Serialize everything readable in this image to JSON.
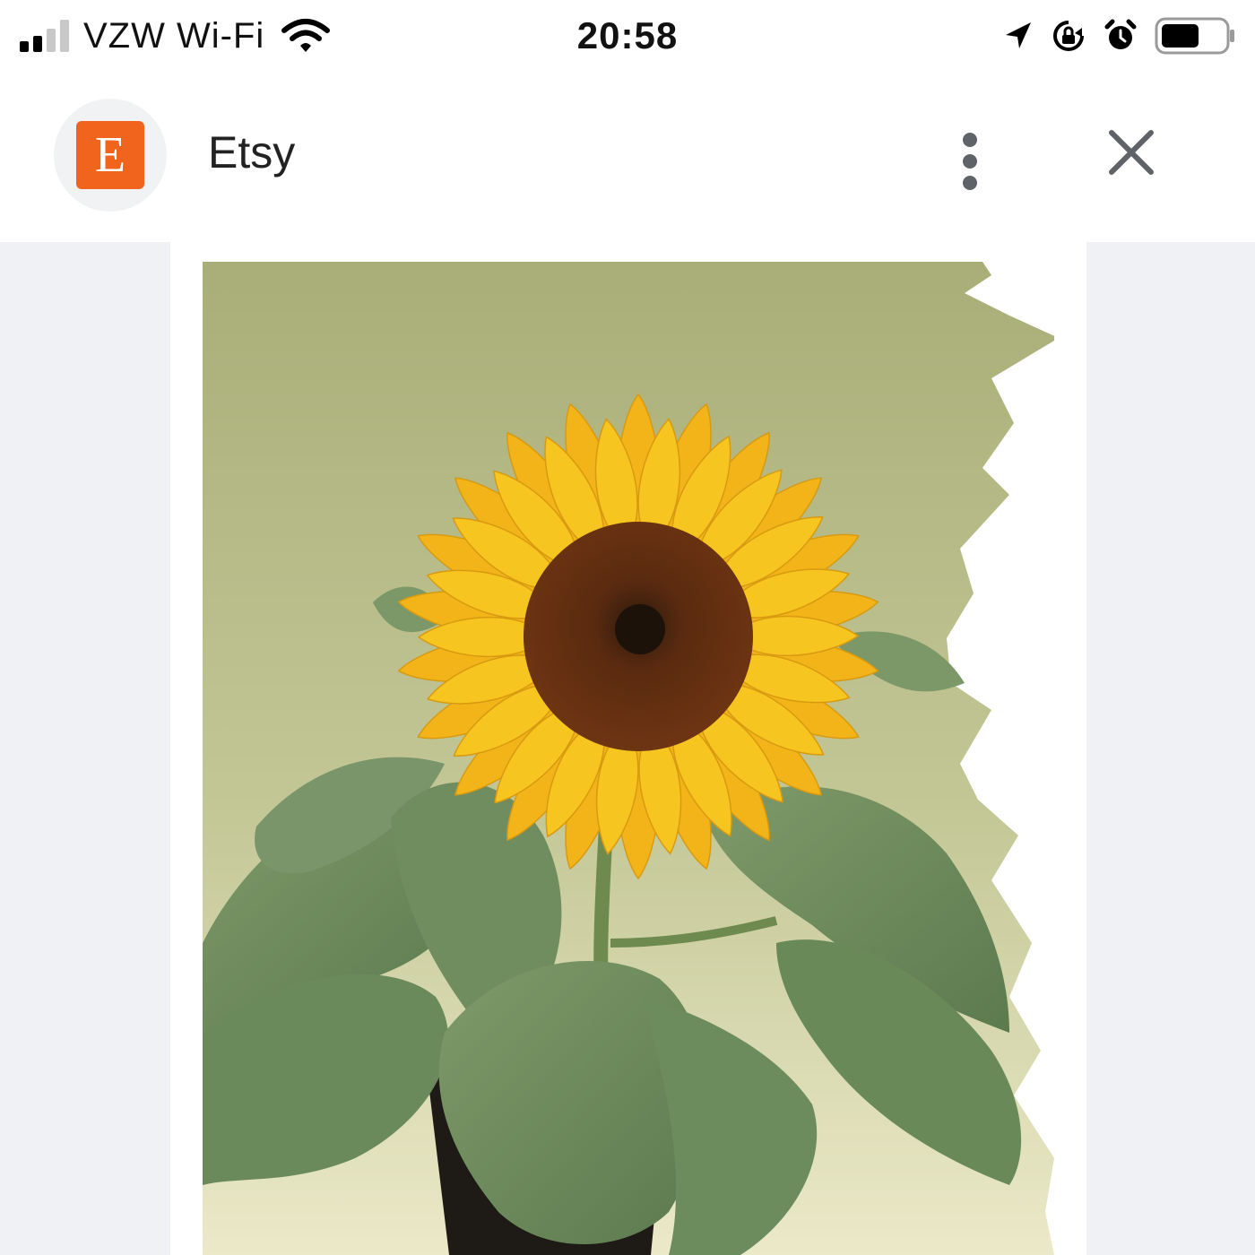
{
  "status_bar": {
    "carrier": "VZW Wi-Fi",
    "time": "20:58",
    "signal_bars_filled": 2,
    "signal_bars_total": 4,
    "battery_level": 0.6,
    "icons": [
      "signal-icon",
      "wifi-icon",
      "location-arrow-icon",
      "orientation-lock-icon",
      "alarm-icon",
      "battery-icon"
    ]
  },
  "header": {
    "logo_letter": "E",
    "title": "Etsy",
    "brand_color": "#f1641e",
    "icons": [
      "more-vertical-icon",
      "close-icon"
    ]
  },
  "content": {
    "image_subject": "sunflower-in-pot",
    "background_color": "#f0f1f4"
  }
}
